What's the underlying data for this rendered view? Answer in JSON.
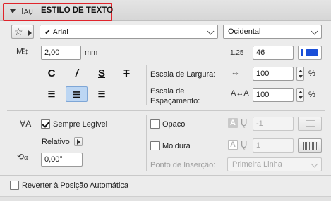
{
  "header": {
    "title": "ESTILO DE TEXTO"
  },
  "font": {
    "name": "Arial",
    "script": "Ocidental"
  },
  "size": {
    "value": "2,00",
    "unit": "mm"
  },
  "pen": {
    "label": "1.25",
    "value": "46",
    "color": "#1a4fd8"
  },
  "format": {
    "bold": "C",
    "italic": "/",
    "underline": "S",
    "strike": "T"
  },
  "width_scale": {
    "label": "Escala de Largura:",
    "value": "100",
    "unit": "%"
  },
  "spacing_scale": {
    "label_line1": "Escala de",
    "label_line2": "Espaçamento:",
    "value": "100",
    "unit": "%"
  },
  "always_readable": {
    "label": "Sempre Legível",
    "checked": true
  },
  "opaque": {
    "label": "Opaco",
    "checked": false,
    "pen_value": "-1"
  },
  "frame": {
    "label": "Moldura",
    "checked": false,
    "pen_value": "1"
  },
  "relative": {
    "label": "Relativo"
  },
  "angle": {
    "value": "0,00°"
  },
  "insertion": {
    "label": "Ponto de Inserção:",
    "value": "Primeira Linha"
  },
  "revert": {
    "label": "Reverter à Posição Automática",
    "checked": false
  },
  "colors": {
    "accent_blue": "#1a4fd8",
    "highlight_red": "#e0242b",
    "selected_bg": "#bcd6f3"
  }
}
